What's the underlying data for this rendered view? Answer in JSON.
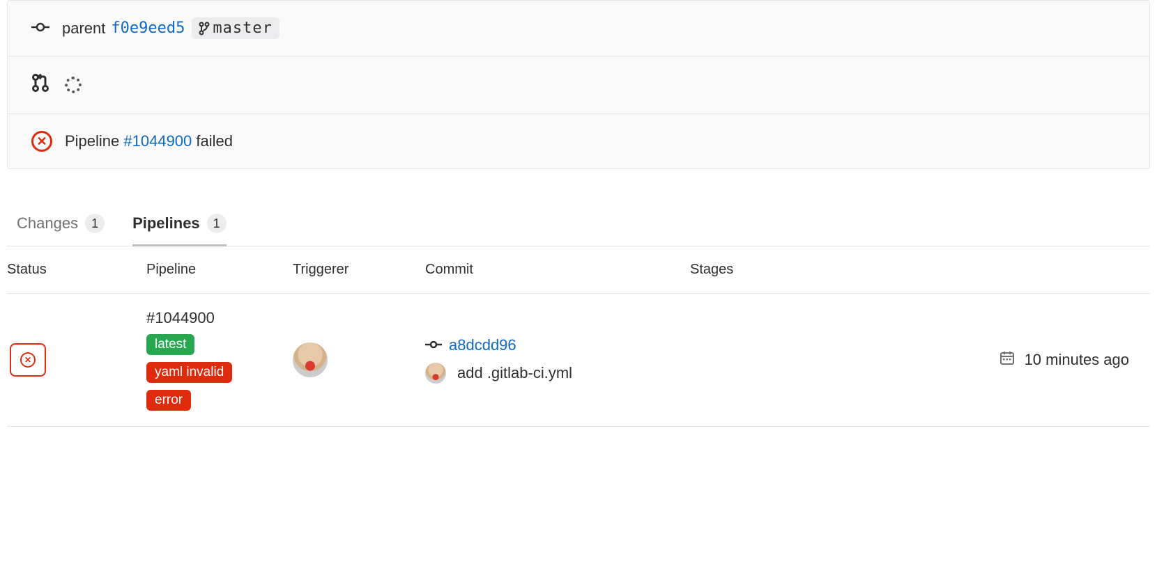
{
  "parent": {
    "label": "parent",
    "sha": "f0e9eed5",
    "branch": "master"
  },
  "pipeline_status": {
    "prefix": "Pipeline ",
    "id": "#1044900",
    "suffix": " failed"
  },
  "tabs": {
    "changes": {
      "label": "Changes",
      "count": "1"
    },
    "pipelines": {
      "label": "Pipelines",
      "count": "1"
    }
  },
  "table": {
    "headers": {
      "status": "Status",
      "pipeline": "Pipeline",
      "triggerer": "Triggerer",
      "commit": "Commit",
      "stages": "Stages"
    },
    "row": {
      "pipeline_id": "#1044900",
      "badges": {
        "latest": "latest",
        "yaml": "yaml invalid",
        "error": "error"
      },
      "commit_sha": "a8dcdd96",
      "commit_msg": "add .gitlab-ci.yml",
      "time": "10 minutes ago"
    }
  }
}
